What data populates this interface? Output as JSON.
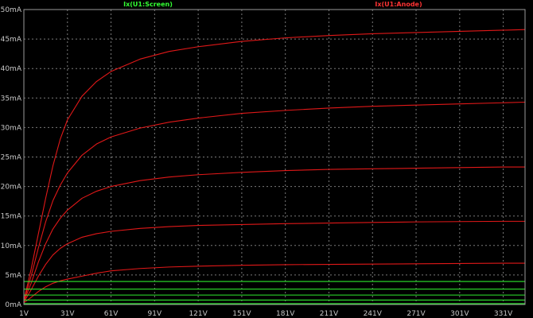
{
  "chart_data": {
    "type": "line",
    "xlim": [
      1,
      346
    ],
    "ylim": [
      0,
      50
    ],
    "x_ticks": [
      "1V",
      "31V",
      "61V",
      "91V",
      "121V",
      "151V",
      "181V",
      "211V",
      "241V",
      "271V",
      "301V",
      "331V"
    ],
    "x_tick_values": [
      1,
      31,
      61,
      91,
      121,
      151,
      181,
      211,
      241,
      271,
      301,
      331
    ],
    "y_ticks": [
      "0mA",
      "5mA",
      "10mA",
      "15mA",
      "20mA",
      "25mA",
      "30mA",
      "35mA",
      "40mA",
      "45mA",
      "50mA"
    ],
    "y_tick_values": [
      0,
      5,
      10,
      15,
      20,
      25,
      30,
      35,
      40,
      45,
      50
    ],
    "grid": true,
    "background": "#000000",
    "grid_color": "#7a7a7a",
    "legend": [
      {
        "label": "Ix(U1:Screen)",
        "color": "#33ff33",
        "placement": "top-left"
      },
      {
        "label": "Ix(U1:Anode)",
        "color": "#ff3333",
        "placement": "top-right"
      }
    ],
    "series": [
      {
        "name": "Ix(U1:Anode)",
        "color": "#e01818",
        "x": [
          1,
          6,
          11,
          16,
          21,
          26,
          31,
          41,
          51,
          61,
          81,
          101,
          121,
          151,
          181,
          211,
          241,
          271,
          301,
          331,
          346
        ],
        "values": [
          0.3,
          1.2,
          2.2,
          3.0,
          3.6,
          4.0,
          4.3,
          4.8,
          5.3,
          5.7,
          6.1,
          6.35,
          6.5,
          6.65,
          6.75,
          6.8,
          6.85,
          6.9,
          6.95,
          7.0,
          7.0
        ]
      },
      {
        "name": "Ix(U1:Anode)",
        "color": "#e01818",
        "x": [
          1,
          6,
          11,
          16,
          21,
          26,
          31,
          41,
          51,
          61,
          81,
          101,
          121,
          151,
          181,
          211,
          241,
          271,
          301,
          331,
          346
        ],
        "values": [
          0.4,
          2.5,
          4.8,
          6.8,
          8.4,
          9.5,
          10.3,
          11.4,
          12.0,
          12.4,
          12.9,
          13.2,
          13.4,
          13.55,
          13.7,
          13.8,
          13.9,
          14.0,
          14.05,
          14.1,
          14.1
        ]
      },
      {
        "name": "Ix(U1:Anode)",
        "color": "#e01818",
        "x": [
          1,
          6,
          11,
          16,
          21,
          26,
          31,
          41,
          51,
          61,
          81,
          101,
          121,
          151,
          181,
          211,
          241,
          271,
          301,
          331,
          346
        ],
        "values": [
          0.5,
          3.6,
          7.2,
          10.3,
          12.8,
          14.6,
          16.0,
          18.0,
          19.2,
          20.0,
          21.0,
          21.6,
          22.0,
          22.4,
          22.7,
          22.9,
          23.0,
          23.1,
          23.2,
          23.3,
          23.3
        ]
      },
      {
        "name": "Ix(U1:Anode)",
        "color": "#e01818",
        "x": [
          1,
          6,
          11,
          16,
          21,
          26,
          31,
          41,
          51,
          61,
          81,
          101,
          121,
          151,
          181,
          211,
          241,
          271,
          301,
          331,
          346
        ],
        "values": [
          0.6,
          4.8,
          9.6,
          14.0,
          17.6,
          20.2,
          22.3,
          25.3,
          27.2,
          28.4,
          29.9,
          30.9,
          31.6,
          32.4,
          32.9,
          33.3,
          33.6,
          33.8,
          34.0,
          34.2,
          34.3
        ]
      },
      {
        "name": "Ix(U1:Anode)",
        "color": "#e01818",
        "x": [
          1,
          6,
          11,
          16,
          21,
          26,
          31,
          41,
          51,
          61,
          81,
          101,
          121,
          151,
          181,
          211,
          241,
          271,
          301,
          331,
          346
        ],
        "values": [
          0.7,
          6.0,
          12.0,
          18.0,
          23.5,
          28.0,
          31.3,
          35.3,
          37.8,
          39.5,
          41.6,
          42.9,
          43.7,
          44.6,
          45.2,
          45.6,
          45.9,
          46.1,
          46.3,
          46.5,
          46.6
        ]
      },
      {
        "name": "Ix(U1:Screen)",
        "color": "#2ee82e",
        "x": [
          1,
          346
        ],
        "values": [
          0.15,
          0.15
        ]
      },
      {
        "name": "Ix(U1:Screen)",
        "color": "#2ee82e",
        "x": [
          1,
          346
        ],
        "values": [
          0.75,
          0.75
        ]
      },
      {
        "name": "Ix(U1:Screen)",
        "color": "#2ee82e",
        "x": [
          1,
          346
        ],
        "values": [
          1.6,
          1.6
        ]
      },
      {
        "name": "Ix(U1:Screen)",
        "color": "#2ee82e",
        "x": [
          1,
          346
        ],
        "values": [
          2.6,
          2.6
        ]
      },
      {
        "name": "Ix(U1:Screen)",
        "color": "#2ee82e",
        "x": [
          1,
          346
        ],
        "values": [
          3.9,
          3.9
        ]
      }
    ]
  }
}
